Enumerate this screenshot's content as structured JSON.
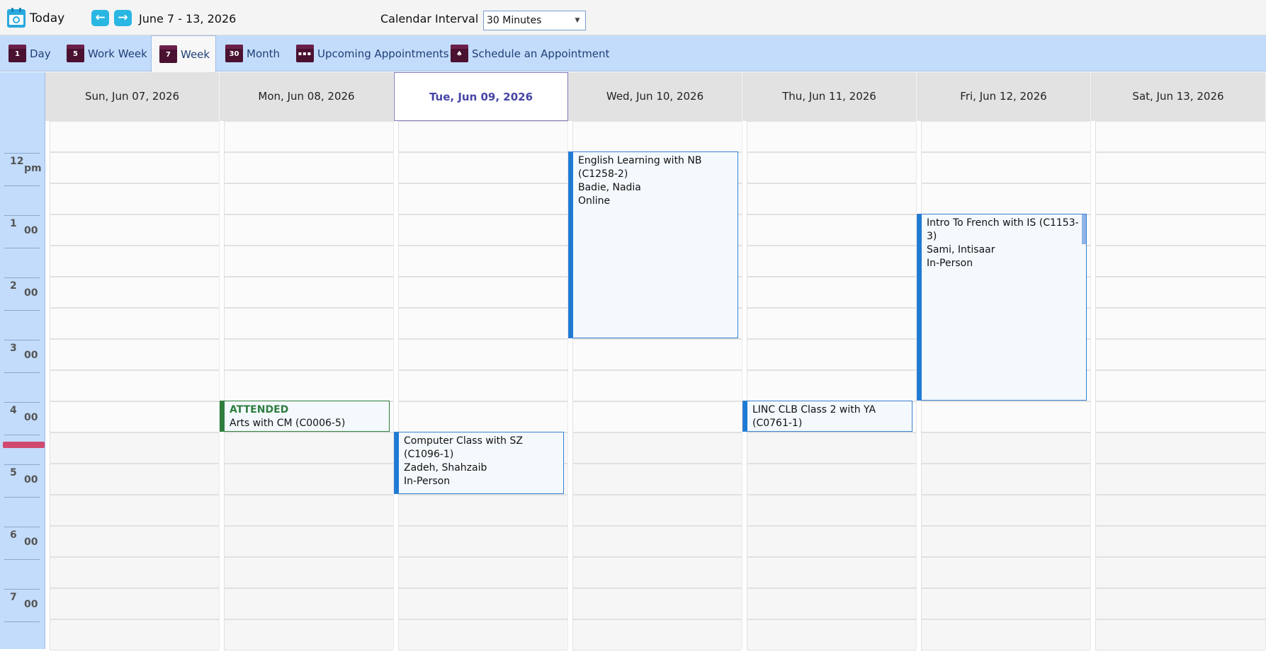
{
  "toolbar": {
    "today_label": "Today",
    "prev_icon": "arrow-left-icon",
    "next_icon": "arrow-right-icon",
    "prev_symbol": "←",
    "next_symbol": "→",
    "range": "June 7 - 13, 2026",
    "interval_label": "Calendar Interval",
    "interval_value": "30 Minutes"
  },
  "tabs": [
    {
      "label": "Day",
      "icon": "1"
    },
    {
      "label": "Work Week",
      "icon": "5"
    },
    {
      "label": "Week",
      "icon": "7",
      "active": true
    },
    {
      "label": "Month",
      "icon": "30"
    },
    {
      "label": "Upcoming Appointments",
      "icon": "▪▪▪"
    },
    {
      "label": "Schedule an Appointment",
      "icon": "♠"
    }
  ],
  "days": [
    "Sun, Jun 07, 2026",
    "Mon, Jun 08, 2026",
    "Tue, Jun 09, 2026",
    "Wed, Jun 10, 2026",
    "Thu, Jun 11, 2026",
    "Fri, Jun 12, 2026",
    "Sat, Jun 13, 2026"
  ],
  "hours": [
    {
      "h": "12",
      "m": "pm"
    },
    {
      "h": "1",
      "m": "00"
    },
    {
      "h": "2",
      "m": "00"
    },
    {
      "h": "3",
      "m": "00"
    },
    {
      "h": "4",
      "m": "00"
    },
    {
      "h": "5",
      "m": "00"
    },
    {
      "h": "6",
      "m": "00"
    },
    {
      "h": "7",
      "m": "00"
    }
  ],
  "appointments": {
    "english": {
      "title": "English Learning  with NB (C1258-2)",
      "person": "Badie, Nadia",
      "mode": "Online"
    },
    "french": {
      "title": "Intro To French with IS (C1153-3)",
      "person": "Sami, Intisaar",
      "mode": "In-Person"
    },
    "arts": {
      "status": "ATTENDED",
      "title": "Arts with CM (C0006-5)"
    },
    "linc": {
      "title": "LINC CLB Class 2 with YA (C0761-1)"
    },
    "computer": {
      "title": "Computer Class with SZ (C1096-1)",
      "person": "Zadeh, Shahzaib",
      "mode": "In-Person"
    }
  },
  "colors": {
    "accent": "#1e7bd4",
    "attended": "#2e7d3e",
    "today_header": "#4646a6",
    "tabbar": "#c3dcfb",
    "now_marker": "#d04a6f"
  }
}
